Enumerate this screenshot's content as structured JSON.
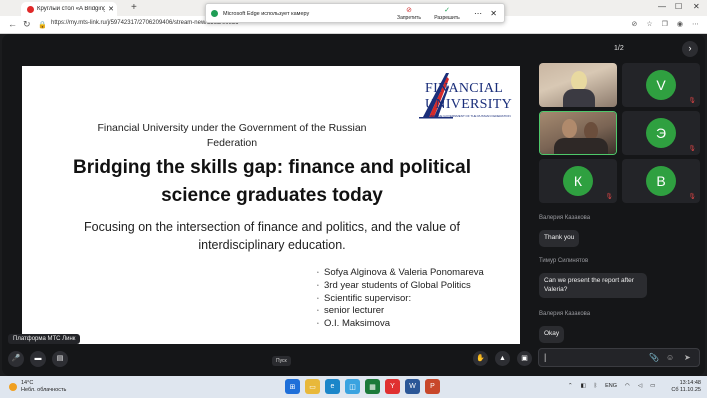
{
  "browser": {
    "tab_title": "Круглый стол «A Bridging t...",
    "url": "https://my.mts-link.ru/j/59742317/2706209406/stream-new/5563/0ffe5c"
  },
  "permission_prompt": {
    "message": "Microsoft Edge использует камеру",
    "deny_label": "Запретить",
    "allow_label": "Разрешить"
  },
  "slide": {
    "logo_line1": "FINANCIAL",
    "logo_line2": "UNIVERSITY",
    "logo_sub": "UNDER THE GOVERNMENT OF THE RUSSIAN FEDERATION",
    "institution": "Financial University under the Government of the Russian Federation",
    "title": "Bridging the skills gap: finance and political science graduates today",
    "subtitle": "Focusing on the intersection of finance and politics, and the value of interdisciplinary education.",
    "authors": [
      "Sofya Alginova & Valeria Ponomareva",
      "3rd year students of Global Politics",
      "Scientific supervisor:",
      "senior lecturer",
      "O.I. Maksimova"
    ]
  },
  "pager": "1/2",
  "participants": [
    {
      "initial": "V",
      "muted": true
    },
    {
      "initial": "Э",
      "muted": true
    },
    {
      "initial": "К",
      "muted": true
    },
    {
      "initial": "В",
      "muted": true
    }
  ],
  "chat": [
    {
      "author": "Валерия Казакова",
      "text": "Thank you"
    },
    {
      "author": "Тимур Силинятов",
      "text": "Can we present the report after Valeria?"
    },
    {
      "author": "Валерия Казакова",
      "text": "Okay"
    }
  ],
  "platform_label": "Платформа МТС Линк",
  "pusk_label": "Пуск",
  "taskbar": {
    "temperature": "14°C",
    "weather": "Небл. облачность",
    "language": "ENG",
    "time": "13:14:48",
    "date": "Сб 11.10.25"
  },
  "colors": {
    "accent_green": "#2fa040",
    "muted_red": "#e04545",
    "logo_blue": "#1a2e7a"
  }
}
